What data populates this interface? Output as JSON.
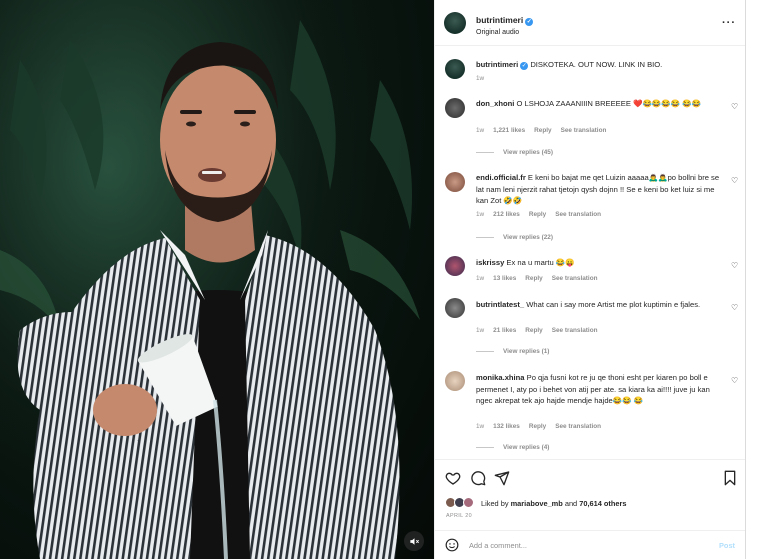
{
  "post": {
    "username": "butrintimeri",
    "audio": "Original audio",
    "more_icon": "more-horizontal-icon"
  },
  "caption": {
    "username": "butrintimeri",
    "text": "DISKOTEKA. OUT NOW. LINK IN BIO.",
    "time": "1w"
  },
  "comments": [
    {
      "username": "don_xhoni",
      "text": "O LSHOJA ZAAANIIIN BREEEEE ❤️😂😂😂😂 😂😂",
      "time": "1w",
      "likes": "1,221 likes",
      "reply": "Reply",
      "translate": "See translation",
      "view_replies": "View replies (45)"
    },
    {
      "username": "endi.official.fr",
      "text": "E keni bo bajat me qet Luizin aaaaa🙇‍♂️🙇‍♂️po bollni bre se lat nam leni njerzit rahat tjetojn qysh dojnn !! Se e keni bo ket luiz si me kan Zot 🤣🤣",
      "time": "1w",
      "likes": "212 likes",
      "reply": "Reply",
      "translate": "See translation",
      "view_replies": "View replies (22)"
    },
    {
      "username": "iskrissy",
      "text": "Ex na u martu 😂😛",
      "time": "1w",
      "likes": "13 likes",
      "reply": "Reply",
      "translate": "See translation",
      "view_replies": ""
    },
    {
      "username": "butrintlatest_",
      "text": "What can i say more Artist me plot kuptimin e fjales.",
      "time": "1w",
      "likes": "21 likes",
      "reply": "Reply",
      "translate": "See translation",
      "view_replies": "View replies (1)"
    },
    {
      "username": "monika.xhina",
      "text": "Po qja fusni kot re ju qe thoni esht per kiaren po boll e permenet I, aty po i behet von atij per ate. sa kiara ka ai!!!! juve ju kan ngec akrepat tek ajo hajde mendje hajde😂😂 😂",
      "time": "1w",
      "likes": "132 likes",
      "reply": "Reply",
      "translate": "See translation",
      "view_replies": "View replies (4)"
    }
  ],
  "actions": {
    "like_icon": "heart-icon",
    "comment_icon": "comment-icon",
    "share_icon": "send-icon",
    "save_icon": "bookmark-icon"
  },
  "likes": {
    "prefix": "Liked by",
    "user": "mariabove_mb",
    "middle": "and",
    "count": "70,614 others"
  },
  "date": "APRIL 20",
  "add_comment": {
    "placeholder": "Add a comment...",
    "post_label": "Post"
  },
  "colors": {
    "accent": "#0095f6",
    "verified": "#3897f0",
    "like_red": "#ed4956",
    "muted": "#8e8e8e"
  }
}
